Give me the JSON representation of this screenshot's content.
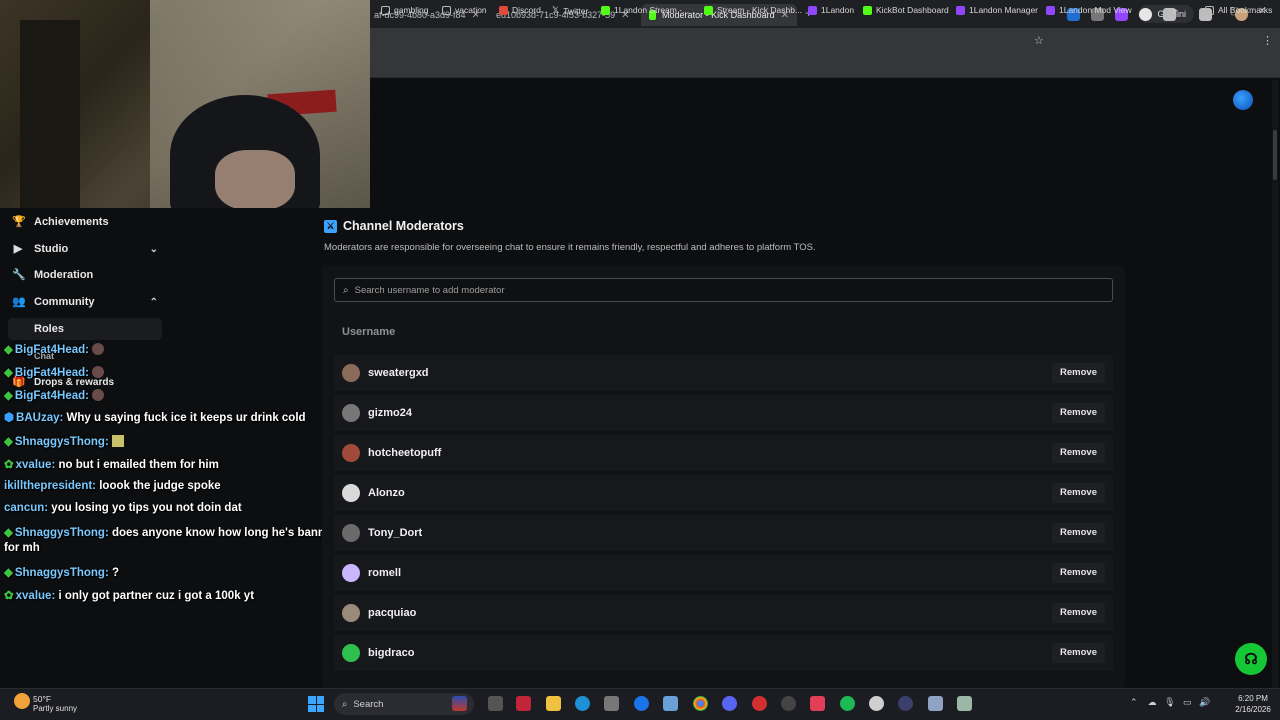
{
  "browser": {
    "tabs": [
      {
        "label": "af-dc99-4b80-a3d9-f84",
        "active": false
      },
      {
        "label": "ed10b93d-71c9-4f53-b327-59",
        "active": false
      },
      {
        "label": "Moderator - Kick Dashboard",
        "active": true
      }
    ],
    "gemini_label": "Gemini",
    "bookmarks": [
      "gambling",
      "vacation",
      "Discord",
      "Twitter",
      "1Landon Stream -...",
      "Stream - Kick Dashb...",
      "1Landon",
      "KickBot Dashboard",
      "1Landon Manager",
      "1Landon Mod View"
    ],
    "all_bookmarks": "All Bookmarks",
    "more": "»"
  },
  "sidebar": {
    "items": [
      {
        "label": "Achievements",
        "icon": "trophy-icon",
        "glyph": "🏆"
      },
      {
        "label": "Studio",
        "icon": "video-icon",
        "glyph": "▶"
      },
      {
        "label": "Moderation",
        "icon": "wrench-icon",
        "glyph": "🔧"
      },
      {
        "label": "Community",
        "icon": "people-icon",
        "glyph": "👥"
      },
      {
        "label": "Roles",
        "icon": "roles-icon",
        "glyph": ""
      },
      {
        "label": "Chat",
        "icon": "chat-icon",
        "glyph": ""
      },
      {
        "label": "Drops & rewards",
        "icon": "gift-icon",
        "glyph": "🎁"
      }
    ]
  },
  "chat_overlay": [
    {
      "user": "BigFat4Head:",
      "message": "",
      "color": "#79c9ff"
    },
    {
      "user": "BigFat4Head:",
      "message": "",
      "color": "#79c9ff"
    },
    {
      "user": "BigFat4Head:",
      "message": "",
      "color": "#79c9ff"
    },
    {
      "user": "BAUzay:",
      "message": "Why u saying fuck ice it keeps ur drink cold",
      "color": "#79c9ff"
    },
    {
      "user": "ShnaggysThong:",
      "message": "",
      "color": "#79c9ff"
    },
    {
      "user": "xvalue:",
      "message": "no but i emailed them for him",
      "color": "#79c9ff"
    },
    {
      "user": "ikillthepresident:",
      "message": "loook the judge spoke",
      "color": "#79c9ff"
    },
    {
      "user": "cancun:",
      "message": "you losing yo tips you not doin dat",
      "color": "#79c9ff"
    },
    {
      "user": "ShnaggysThong:",
      "message": "does anyone know how long he's banned",
      "color": "#79c9ff"
    },
    {
      "user": "",
      "message": "for mh",
      "color": "#79c9ff"
    },
    {
      "user": "ShnaggysThong:",
      "message": "?",
      "color": "#79c9ff"
    },
    {
      "user": "xvalue:",
      "message": "i only got partner cuz i got a 100k yt",
      "color": "#79c9ff"
    }
  ],
  "moderators": {
    "title": "Channel Moderators",
    "description": "Moderators are responsible for overseeing chat to ensure it remains friendly, respectful and adheres to platform TOS.",
    "search_placeholder": "Search username to add moderator",
    "column_username": "Username",
    "remove_label": "Remove",
    "rows": [
      {
        "name": "sweatergxd",
        "avatar_color": "#8a6b5a"
      },
      {
        "name": "gizmo24",
        "avatar_color": "#777777"
      },
      {
        "name": "hotcheetopuff",
        "avatar_color": "#a14a3a"
      },
      {
        "name": "Alonzo",
        "avatar_color": "#d9d9d9"
      },
      {
        "name": "Tony_Dort",
        "avatar_color": "#6a6a6a"
      },
      {
        "name": "romell",
        "avatar_color": "#c9b6ff"
      },
      {
        "name": "pacquiao",
        "avatar_color": "#9a8a7a"
      },
      {
        "name": "bigdraco",
        "avatar_color": "#2fbf4f"
      }
    ]
  },
  "taskbar": {
    "weather_temp": "50°F",
    "weather_desc": "Partly sunny",
    "search_label": "Search",
    "time": "6:20 PM",
    "date": "2/16/2026"
  }
}
